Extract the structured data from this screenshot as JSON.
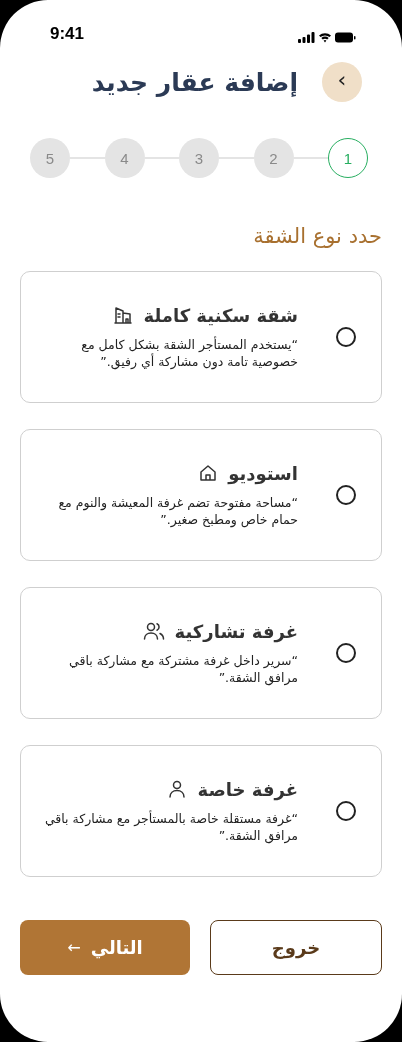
{
  "status_bar": {
    "time": "9:41"
  },
  "header": {
    "back_label": "›",
    "title": "إضافة عقار جديد"
  },
  "steps": [
    {
      "label": "1",
      "selected": true
    },
    {
      "label": "2",
      "selected": false
    },
    {
      "label": "3",
      "selected": false
    },
    {
      "label": "4",
      "selected": false
    },
    {
      "label": "5",
      "selected": false
    }
  ],
  "section_title": "حدد نوع الشقة",
  "options": [
    {
      "kind": "apartment",
      "title": "شقة سكنية كاملة",
      "description": "“يستخدم المستأجر الشقة بشكل كامل مع خصوصية تامة دون مشاركة أي رفيق.”",
      "selected": false
    },
    {
      "kind": "studio",
      "title": "استوديو",
      "description": "“مساحة مفتوحة تضم غرفة المعيشة والنوم مع حمام خاص ومطبخ صغير.”",
      "selected": false
    },
    {
      "kind": "shared",
      "title": "غرفة تشاركية",
      "description": "“سرير داخل غرفة مشتركة مع مشاركة باقي مرافق الشقة.”",
      "selected": false
    },
    {
      "kind": "private",
      "title": "غرفة خاصة",
      "description": "“غرفة مستقلة خاصة بالمستأجر مع مشاركة باقي مرافق الشقة.”",
      "selected": false
    }
  ],
  "buttons": {
    "exit": "خروج",
    "next": "التالي",
    "next_arrow": "←"
  }
}
